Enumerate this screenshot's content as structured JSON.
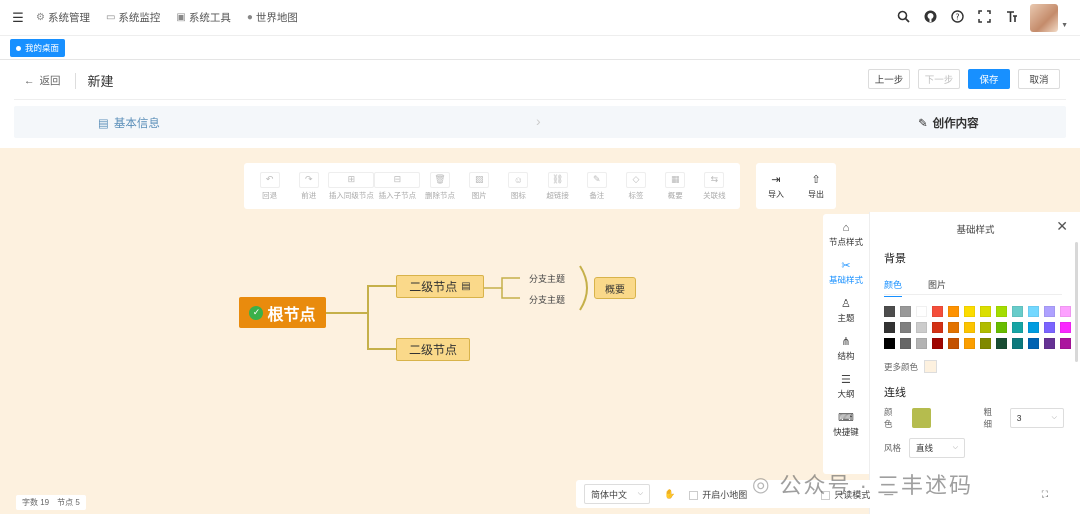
{
  "topbar": {
    "menu": [
      {
        "icon": "gear-icon",
        "label": "系统管理"
      },
      {
        "icon": "monitor-icon",
        "label": "系统监控"
      },
      {
        "icon": "toolbox-icon",
        "label": "系统工具"
      },
      {
        "icon": "globe-icon",
        "label": "世界地图"
      }
    ],
    "right_icons": [
      "search-icon",
      "github-icon",
      "help-icon",
      "fullscreen-icon",
      "font-size-icon"
    ]
  },
  "tags": {
    "active": "我的桌面"
  },
  "header": {
    "back": "返回",
    "title": "新建",
    "buttons": {
      "undo": "上一步",
      "redo": "下一步",
      "save": "保存",
      "cancel": "取消"
    }
  },
  "steps": {
    "step1": "基本信息",
    "step2": "创作内容"
  },
  "toolbar": {
    "items": [
      {
        "icon": "undo-icon",
        "label": "回退"
      },
      {
        "icon": "redo-icon",
        "label": "前进"
      },
      {
        "icon": "sibling-node-icon",
        "label": "插入同级节点"
      },
      {
        "icon": "child-node-icon",
        "label": "插入子节点"
      },
      {
        "icon": "delete-icon",
        "label": "删除节点"
      },
      {
        "icon": "image-icon",
        "label": "图片"
      },
      {
        "icon": "emoji-icon",
        "label": "图标"
      },
      {
        "icon": "link-icon",
        "label": "超链接"
      },
      {
        "icon": "note-icon",
        "label": "备注"
      },
      {
        "icon": "tag-icon",
        "label": "标签"
      },
      {
        "icon": "summary-icon",
        "label": "概要"
      },
      {
        "icon": "relation-icon",
        "label": "关联线"
      }
    ],
    "import": "导入",
    "export": "导出"
  },
  "sidenav": [
    {
      "icon": "node-style-icon",
      "label": "节点样式"
    },
    {
      "icon": "base-style-icon",
      "label": "基础样式"
    },
    {
      "icon": "theme-icon",
      "label": "主题"
    },
    {
      "icon": "structure-icon",
      "label": "结构"
    },
    {
      "icon": "outline-icon",
      "label": "大纲"
    },
    {
      "icon": "keyboard-icon",
      "label": "快捷键"
    }
  ],
  "panel": {
    "title": "基础样式",
    "background": "背景",
    "tabs": {
      "color": "颜色",
      "image": "图片"
    },
    "more_colors": "更多颜色",
    "line": "连线",
    "line_color_label": "颜色",
    "line_width_label": "粗细",
    "line_width_value": "3",
    "line_style_label": "风格",
    "line_style_value": "直线",
    "palette": [
      "#4d4d4d",
      "#999999",
      "#ffffff",
      "#f44e3b",
      "#fe9200",
      "#fcdc00",
      "#dbdf00",
      "#a4dd00",
      "#68ccca",
      "#73d8ff",
      "#aea1ff",
      "#fda1ff",
      "#333333",
      "#808080",
      "#cccccc",
      "#d33115",
      "#e27300",
      "#fcc400",
      "#b0bc00",
      "#68bc00",
      "#16a5a5",
      "#009ce0",
      "#7b64ff",
      "#fa28ff",
      "#000000",
      "#666666",
      "#b3b3b3",
      "#9f0500",
      "#c45100",
      "#fb9e00",
      "#808900",
      "#194d33",
      "#0c797d",
      "#0062b1",
      "#653294",
      "#ab149e"
    ],
    "bg_color": "#fdf1df",
    "line_color": "#b5bc4e"
  },
  "mindmap": {
    "root": "根节点",
    "level2": [
      "二级节点",
      "二级节点"
    ],
    "branches": [
      "分支主题",
      "分支主题"
    ],
    "summary": "概要"
  },
  "bottombar": {
    "lang": "简体中文",
    "minimap": "开启小地图",
    "mode": "只读模式"
  },
  "counter": {
    "words": "字数 19",
    "nodes": "节点 5"
  },
  "watermark": "公众号 · 三丰述码"
}
